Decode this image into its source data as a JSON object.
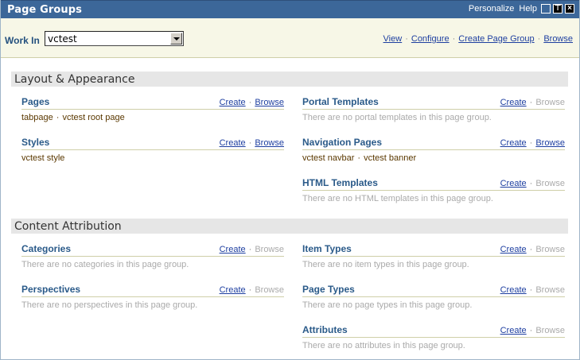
{
  "titlebar": {
    "title": "Page Groups",
    "personalize": "Personalize",
    "help": "Help",
    "btn_max": "⊤",
    "btn_close": "×"
  },
  "toolbar": {
    "work_in_label": "Work In",
    "work_in_value": "vctest",
    "links": [
      "View",
      "Configure",
      "Create Page Group",
      "Browse"
    ]
  },
  "sections": [
    {
      "title": "Layout & Appearance",
      "left": [
        {
          "name": "Pages",
          "create": "Create",
          "browse": "Browse",
          "browse_enabled": true,
          "items": [
            "tabpage",
            "vctest root page"
          ],
          "empty": ""
        },
        {
          "name": "Styles",
          "create": "Create",
          "browse": "Browse",
          "browse_enabled": true,
          "items": [
            "vctest style"
          ],
          "empty": ""
        }
      ],
      "right": [
        {
          "name": "Portal Templates",
          "create": "Create",
          "browse": "Browse",
          "browse_enabled": false,
          "items": [],
          "empty": "There are no portal templates in this page group."
        },
        {
          "name": "Navigation Pages",
          "create": "Create",
          "browse": "Browse",
          "browse_enabled": true,
          "items": [
            "vctest navbar",
            "vctest banner"
          ],
          "empty": ""
        },
        {
          "name": "HTML Templates",
          "create": "Create",
          "browse": "Browse",
          "browse_enabled": false,
          "items": [],
          "empty": "There are no HTML templates in this page group."
        }
      ]
    },
    {
      "title": "Content Attribution",
      "left": [
        {
          "name": "Categories",
          "create": "Create",
          "browse": "Browse",
          "browse_enabled": false,
          "items": [],
          "empty": "There are no categories in this page group."
        },
        {
          "name": "Perspectives",
          "create": "Create",
          "browse": "Browse",
          "browse_enabled": false,
          "items": [],
          "empty": "There are no perspectives in this page group."
        }
      ],
      "right": [
        {
          "name": "Item Types",
          "create": "Create",
          "browse": "Browse",
          "browse_enabled": false,
          "items": [],
          "empty": "There are no item types in this page group."
        },
        {
          "name": "Page Types",
          "create": "Create",
          "browse": "Browse",
          "browse_enabled": false,
          "items": [],
          "empty": "There are no page types in this page group."
        },
        {
          "name": "Attributes",
          "create": "Create",
          "browse": "Browse",
          "browse_enabled": false,
          "items": [],
          "empty": "There are no attributes in this page group."
        }
      ]
    }
  ]
}
